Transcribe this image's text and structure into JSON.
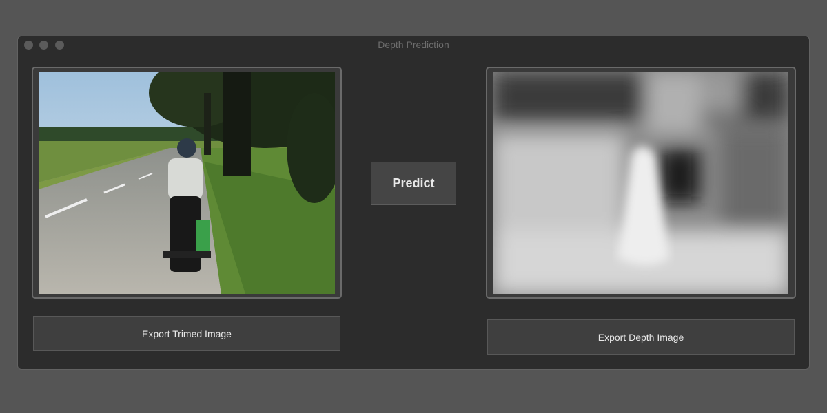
{
  "window": {
    "title": "Depth Prediction"
  },
  "buttons": {
    "predict": "Predict",
    "export_trimmed": "Export Trimed Image",
    "export_depth": "Export Depth Image"
  }
}
